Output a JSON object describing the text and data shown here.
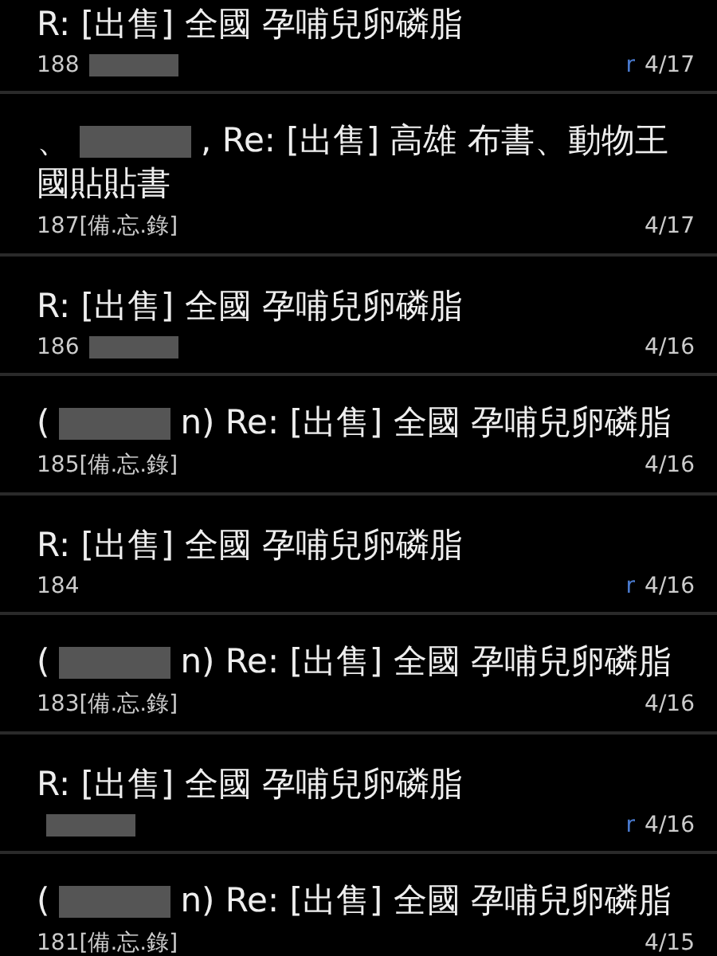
{
  "rows": [
    {
      "title_prefix": "",
      "title_redacted": false,
      "title": "R: [出售] 全國 孕哺兒卵磷脂",
      "number": "188",
      "sender_redacted": true,
      "tag": "",
      "reply_mark": "r",
      "date": "4/17"
    },
    {
      "title_prefix": "、",
      "title_redacted": true,
      "title": ", Re: [出售] 高雄 布書、動物王",
      "title_continued": "國貼貼書",
      "number": "187",
      "sender_redacted": false,
      "tag": "[備.忘.錄]",
      "reply_mark": "",
      "date": "4/17"
    },
    {
      "title_prefix": "",
      "title_redacted": false,
      "title": "R: [出售] 全國 孕哺兒卵磷脂",
      "number": "186",
      "sender_redacted": true,
      "tag": "",
      "reply_mark": "",
      "date": "4/16"
    },
    {
      "title_prefix": "(",
      "title_redacted": true,
      "title": "n) Re: [出售] 全國 孕哺兒卵磷脂",
      "number": "185",
      "sender_redacted": false,
      "tag": "[備.忘.錄]",
      "reply_mark": "",
      "date": "4/16"
    },
    {
      "title_prefix": "",
      "title_redacted": false,
      "title": "R: [出售] 全國 孕哺兒卵磷脂",
      "number": "184",
      "sender_redacted": false,
      "tag": "",
      "reply_mark": "r",
      "date": "4/16"
    },
    {
      "title_prefix": "(",
      "title_redacted": true,
      "title": "n) Re: [出售] 全國 孕哺兒卵磷脂",
      "number": "183",
      "sender_redacted": false,
      "tag": "[備.忘.錄]",
      "reply_mark": "",
      "date": "4/16"
    },
    {
      "title_prefix": "",
      "title_redacted": false,
      "title": "R: [出售] 全國 孕哺兒卵磷脂",
      "number": "",
      "sender_redacted": true,
      "tag": "",
      "reply_mark": "r",
      "date": "4/16"
    },
    {
      "title_prefix": "(",
      "title_redacted": true,
      "title": "n) Re: [出售] 全國 孕哺兒卵磷脂",
      "number": "181",
      "sender_redacted": false,
      "tag": "[備.忘.錄]",
      "reply_mark": "",
      "date": "4/15"
    }
  ]
}
